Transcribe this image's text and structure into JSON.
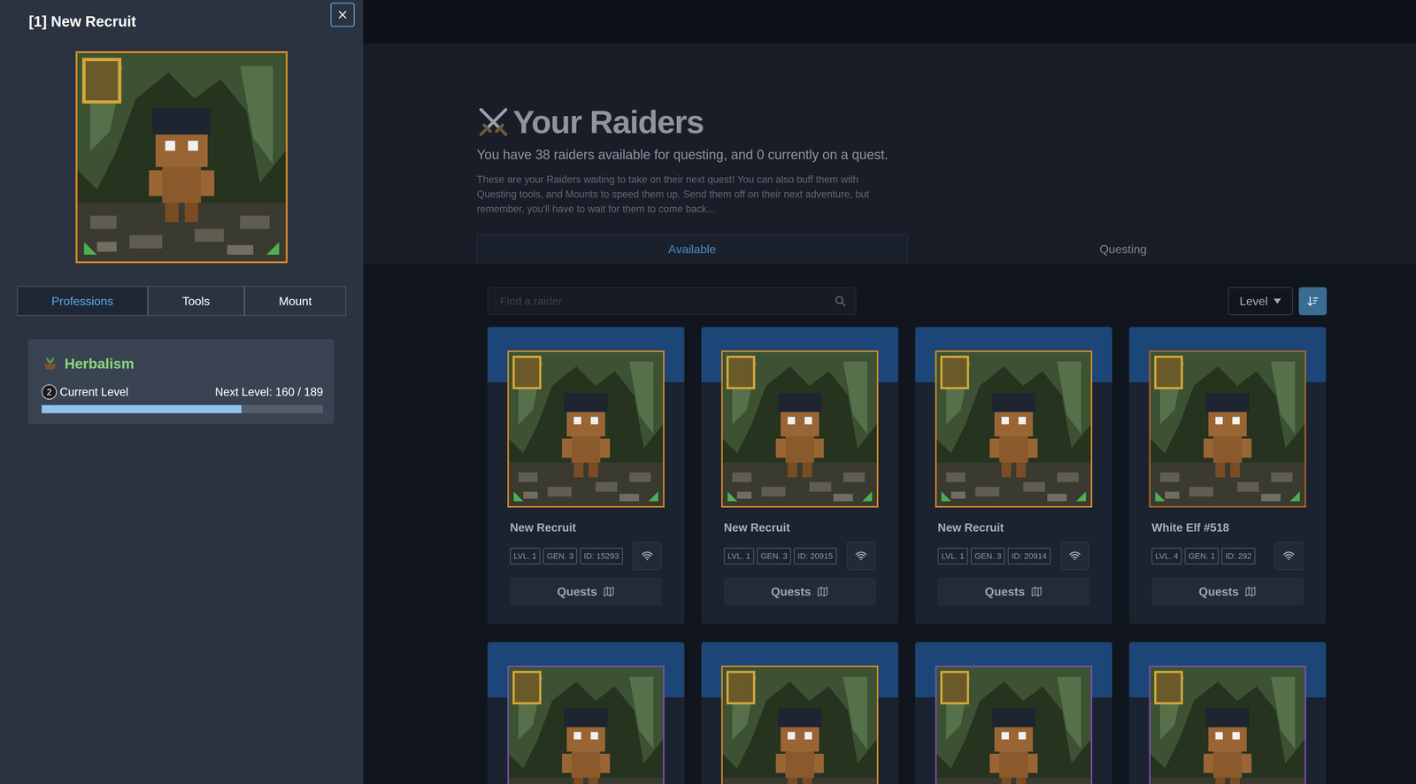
{
  "drawer": {
    "title": "[1] New Recruit",
    "tabs": [
      {
        "label": "Professions",
        "selected": true
      },
      {
        "label": "Tools",
        "selected": false
      },
      {
        "label": "Mount",
        "selected": false
      }
    ],
    "professions": [
      {
        "name": "Herbalism",
        "rank": "2",
        "rank_label": "Current Level",
        "next_level": "Next Level: 160 / 189",
        "level": 0.71
      }
    ]
  },
  "page": {
    "title": "Your Raiders",
    "subtitle": "You have 38 raiders available for questing, and 0 currently on a quest.",
    "description": "These are your Raiders waiting to take on their next quest! You can also buff them with Questing tools, and Mounts to speed them up. Send them off on their next adventure, but remember, you'll have to wait for them to come back...",
    "tabs": [
      {
        "label": "Available",
        "selected": true
      },
      {
        "label": "Questing",
        "selected": false
      }
    ],
    "search": {
      "placeholder": "Find a raider"
    },
    "sort": {
      "label": "Level"
    }
  },
  "raiders": [
    {
      "name": "New Recruit",
      "level": "LVL. 1",
      "gen": "GEN. 3",
      "id": "ID: 15293",
      "action": "Quests",
      "color": "#d98a25"
    },
    {
      "name": "New Recruit",
      "level": "LVL. 1",
      "gen": "GEN. 3",
      "id": "ID: 20915",
      "action": "Quests",
      "color": "#d98a25"
    },
    {
      "name": "New Recruit",
      "level": "LVL. 1",
      "gen": "GEN. 3",
      "id": "ID: 20914",
      "action": "Quests",
      "color": "#d98a25"
    },
    {
      "name": "White Elf #518",
      "level": "LVL. 4",
      "gen": "GEN. 1",
      "id": "ID: 292",
      "action": "Quests",
      "color": "#b0642a"
    }
  ],
  "more_raiders": [
    {
      "color": "#7a4fb0"
    },
    {
      "color": "#d98a25"
    },
    {
      "color": "#7a4fb0"
    },
    {
      "color": "#7a4fb0"
    }
  ]
}
